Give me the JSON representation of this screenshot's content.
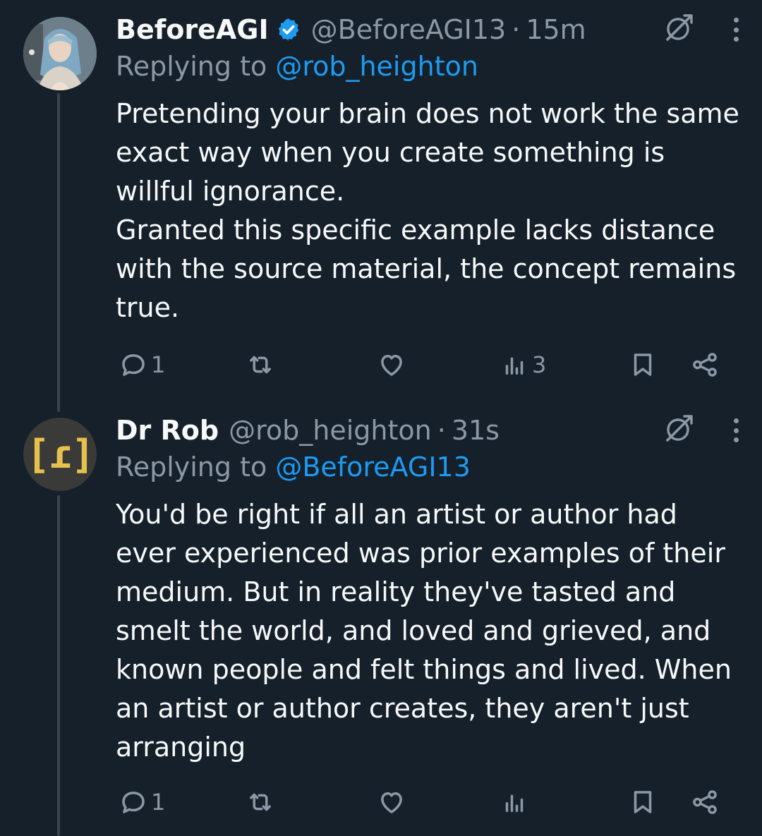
{
  "tweets": [
    {
      "name": "BeforeAGI",
      "verified": true,
      "handle": "@BeforeAGI13",
      "time": "15m",
      "replying_label": "Replying to ",
      "replying_handle": "@rob_heighton",
      "text": "Pretending your brain does not work the same exact way when you create something is willful ignorance.\nGranted this specific example lacks distance with the source material, the concept remains true.",
      "replies": "1",
      "reposts": "",
      "likes": "",
      "views": "3"
    },
    {
      "name": "Dr Rob",
      "verified": false,
      "handle": "@rob_heighton",
      "time": "31s",
      "replying_label": "Replying to ",
      "replying_handle": "@BeforeAGI13",
      "avatar_glyph": "[ɾ]",
      "text": "You'd be right if all an artist or author had ever experienced was prior examples of their medium. But in reality they've tasted and smelt the world, and loved and grieved, and known people and felt things and lived. When an artist or author creates, they aren't just arranging",
      "replies": "1",
      "reposts": "",
      "likes": "",
      "views": ""
    }
  ],
  "separator": "·",
  "colors": {
    "background": "#15202b",
    "text": "#f7f9f9",
    "muted": "#8b98a5",
    "link": "#1d9bf0",
    "thread_line": "#38444d",
    "verified": "#1d9bf0",
    "avatar_glyph": "#e7c14e"
  },
  "icons": {
    "verified": "verified-badge-icon",
    "grok": "grok-icon",
    "more": "more-vertical-icon",
    "reply": "reply-icon",
    "repost": "repost-icon",
    "like": "heart-icon",
    "views": "views-icon",
    "bookmark": "bookmark-icon",
    "share": "share-icon"
  }
}
